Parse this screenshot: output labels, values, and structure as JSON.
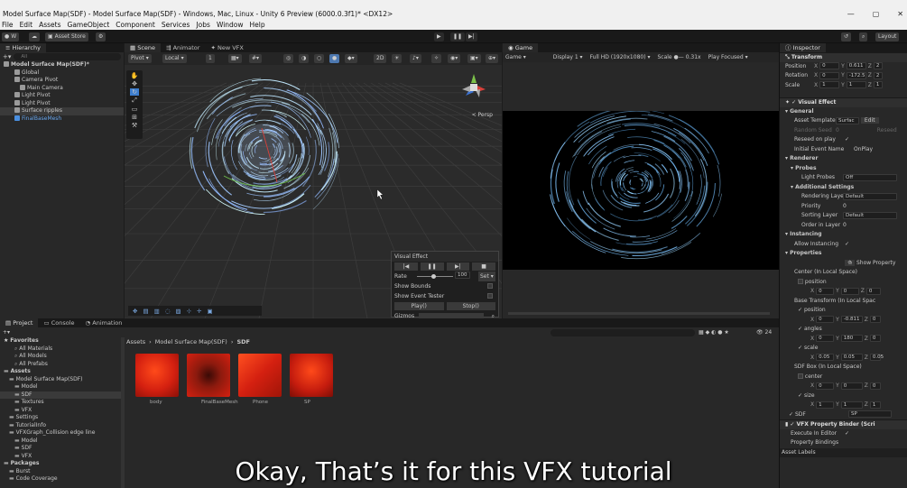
{
  "window": {
    "title": "Model Surface Map(SDF) - Model Surface Map(SDF) - Windows, Mac, Linux - Unity 6 Preview (6000.0.3f1)* <DX12>",
    "controls": [
      "—",
      "▢",
      "✕"
    ]
  },
  "menu": [
    "File",
    "Edit",
    "Assets",
    "GameObject",
    "Component",
    "Services",
    "Jobs",
    "Window",
    "Help"
  ],
  "toolbar": {
    "account": "W",
    "asset_store": "Asset Store",
    "layout": "Layout"
  },
  "hierarchy": {
    "tab": "Hierarchy",
    "search_placeholder": "All",
    "items": [
      {
        "label": "Model Surface Map(SDF)*",
        "indent": 0
      },
      {
        "label": "Global",
        "indent": 2
      },
      {
        "label": "Camera Pivot",
        "indent": 2
      },
      {
        "label": "Main Camera",
        "indent": 3
      },
      {
        "label": "Light Pivot",
        "indent": 2
      },
      {
        "label": "Light Pivot",
        "indent": 2
      },
      {
        "label": "Surface ripples",
        "indent": 2,
        "selected": true
      },
      {
        "label": "FinalBaseMesh",
        "indent": 2,
        "blue": true
      }
    ]
  },
  "scene": {
    "tabs": [
      "Scene",
      "Animator",
      "New VFX"
    ],
    "pivot": "Pivot",
    "local": "Local",
    "step": "1",
    "mode2d": "2D",
    "persp": "< Persp"
  },
  "vfx_panel": {
    "title": "Visual Effect",
    "rate_label": "Rate",
    "rate_value": "100",
    "rate_btn": "Set",
    "show_bounds": "Show Bounds",
    "show_event": "Show Event Tester",
    "play": "Play()",
    "stop": "Stop()",
    "gizmos": "Gizmos"
  },
  "game": {
    "tab": "Game",
    "mode": "Game",
    "display": "Display 1",
    "resolution": "Full HD (1920x1080)",
    "scale_label": "Scale",
    "scale_value": "0.31x",
    "play_focused": "Play Focused"
  },
  "inspector": {
    "tab": "Inspector",
    "transform": "Transform",
    "position": {
      "label": "Position",
      "x": "0",
      "y": "0.611",
      "z": "2"
    },
    "rotation": {
      "label": "Rotation",
      "x": "0",
      "y": "-172.5",
      "z": "2"
    },
    "scale": {
      "label": "Scale",
      "x": "1",
      "y": "1",
      "z": "1"
    },
    "visual_effect": "Visual Effect",
    "general": "General",
    "asset_template": {
      "label": "Asset Template",
      "value": "Surfac",
      "btn": "Edit"
    },
    "random_seed": {
      "label": "Random Seed",
      "value": "0",
      "btn": "Reseed"
    },
    "reseed_on_play": "Reseed on play",
    "initial_event": {
      "label": "Initial Event Name",
      "value": "OnPlay"
    },
    "renderer": "Renderer",
    "probes": "Probes",
    "light_probes": {
      "label": "Light Probes",
      "value": "Off"
    },
    "additional": "Additional Settings",
    "rendering_layer": {
      "label": "Rendering Laye",
      "value": "Default"
    },
    "priority": {
      "label": "Priority",
      "value": "0"
    },
    "sorting_layer": {
      "label": "Sorting Layer",
      "value": "Default"
    },
    "order_in_layer": {
      "label": "Order in Layer",
      "value": "0"
    },
    "instancing": "Instancing",
    "allow_instancing": "Allow Instancing",
    "properties": "Properties",
    "show_property": "Show Property",
    "center_local": "Center (In Local Space)",
    "position_lbl": "position",
    "center_pos": {
      "x": "0",
      "y": "0",
      "z": "0"
    },
    "base_transform": "Base Transform (In Local Spac",
    "bt_position_lbl": "position",
    "bt_position": {
      "x": "0",
      "y": "-0.811",
      "z": "0"
    },
    "angles_lbl": "angles",
    "bt_angles": {
      "x": "0",
      "y": "180",
      "z": "0"
    },
    "scale_lbl": "scale",
    "bt_scale": {
      "x": "0.05",
      "y": "0.05",
      "z": "0.05"
    },
    "sdf_box": "SDF Box (In Local Space)",
    "center_lbl": "center",
    "sdf_center": {
      "x": "0",
      "y": "0",
      "z": "0"
    },
    "size_lbl": "size",
    "sdf_size": {
      "x": "1",
      "y": "1",
      "z": "1"
    },
    "sdf_lbl": "SDF",
    "sdf_val": "SP",
    "binder": "VFX Property Binder (Scri",
    "execute_in_editor": "Execute In Editor",
    "property_bindings": "Property Bindings",
    "asset_labels": "Asset Labels"
  },
  "project": {
    "tabs": [
      "Project",
      "Console",
      "Animation"
    ],
    "breadcrumb": [
      "Assets",
      "Model Surface Map(SDF)",
      "SDF"
    ],
    "badge": "24",
    "tree": [
      {
        "label": "Favorites",
        "indent": 0,
        "bold": true
      },
      {
        "label": "All Materials",
        "indent": 2
      },
      {
        "label": "All Models",
        "indent": 2
      },
      {
        "label": "All Prefabs",
        "indent": 2
      },
      {
        "label": "Assets",
        "indent": 0,
        "bold": true
      },
      {
        "label": "Model Surface Map(SDF)",
        "indent": 1
      },
      {
        "label": "Model",
        "indent": 2
      },
      {
        "label": "SDF",
        "indent": 2,
        "selected": true
      },
      {
        "label": "Textures",
        "indent": 2
      },
      {
        "label": "VFX",
        "indent": 2
      },
      {
        "label": "Settings",
        "indent": 1
      },
      {
        "label": "TutorialInfo",
        "indent": 1
      },
      {
        "label": "VFXGraph_Collision edge line",
        "indent": 1
      },
      {
        "label": "Model",
        "indent": 2
      },
      {
        "label": "SDF",
        "indent": 2
      },
      {
        "label": "VFX",
        "indent": 2
      },
      {
        "label": "Packages",
        "indent": 0,
        "bold": true
      },
      {
        "label": "Burst",
        "indent": 1
      },
      {
        "label": "Code Coverage",
        "indent": 1
      }
    ],
    "assets": [
      {
        "label": "body"
      },
      {
        "label": "FinalBaseMesh"
      },
      {
        "label": "Phone"
      },
      {
        "label": "SP"
      }
    ]
  },
  "subtitle": "Okay, That’s it for this VFX tutorial",
  "colors": {
    "accent": "#3d7ecf",
    "selected_row": "#2c5d87",
    "thumb_red": "#d42010"
  }
}
